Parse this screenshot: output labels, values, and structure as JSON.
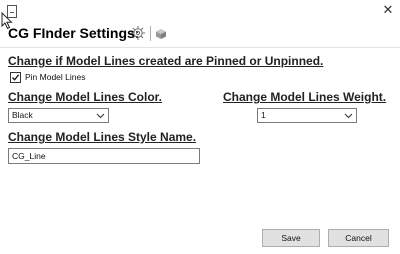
{
  "window": {
    "close_glyph": "✕"
  },
  "header": {
    "title": "CG FInder Settings:",
    "icons": [
      "gear-icon",
      "cube-icon"
    ]
  },
  "pin_section": {
    "heading": "Change if Model Lines created are Pinned or Unpinned.",
    "checkbox_label": "Pin Model Lines",
    "checked": true
  },
  "color_section": {
    "heading": "Change Model Lines Color.",
    "selected": "Black"
  },
  "weight_section": {
    "heading": "Change Model Lines Weight.",
    "selected": "1"
  },
  "style_section": {
    "heading": "Change Model Lines Style Name.",
    "value": "CG_Line"
  },
  "footer": {
    "save_label": "Save",
    "cancel_label": "Cancel"
  },
  "colors": {
    "window_bg": "#ffffff",
    "button_bg": "#e1e1e1",
    "border": "#7a7a7a"
  }
}
